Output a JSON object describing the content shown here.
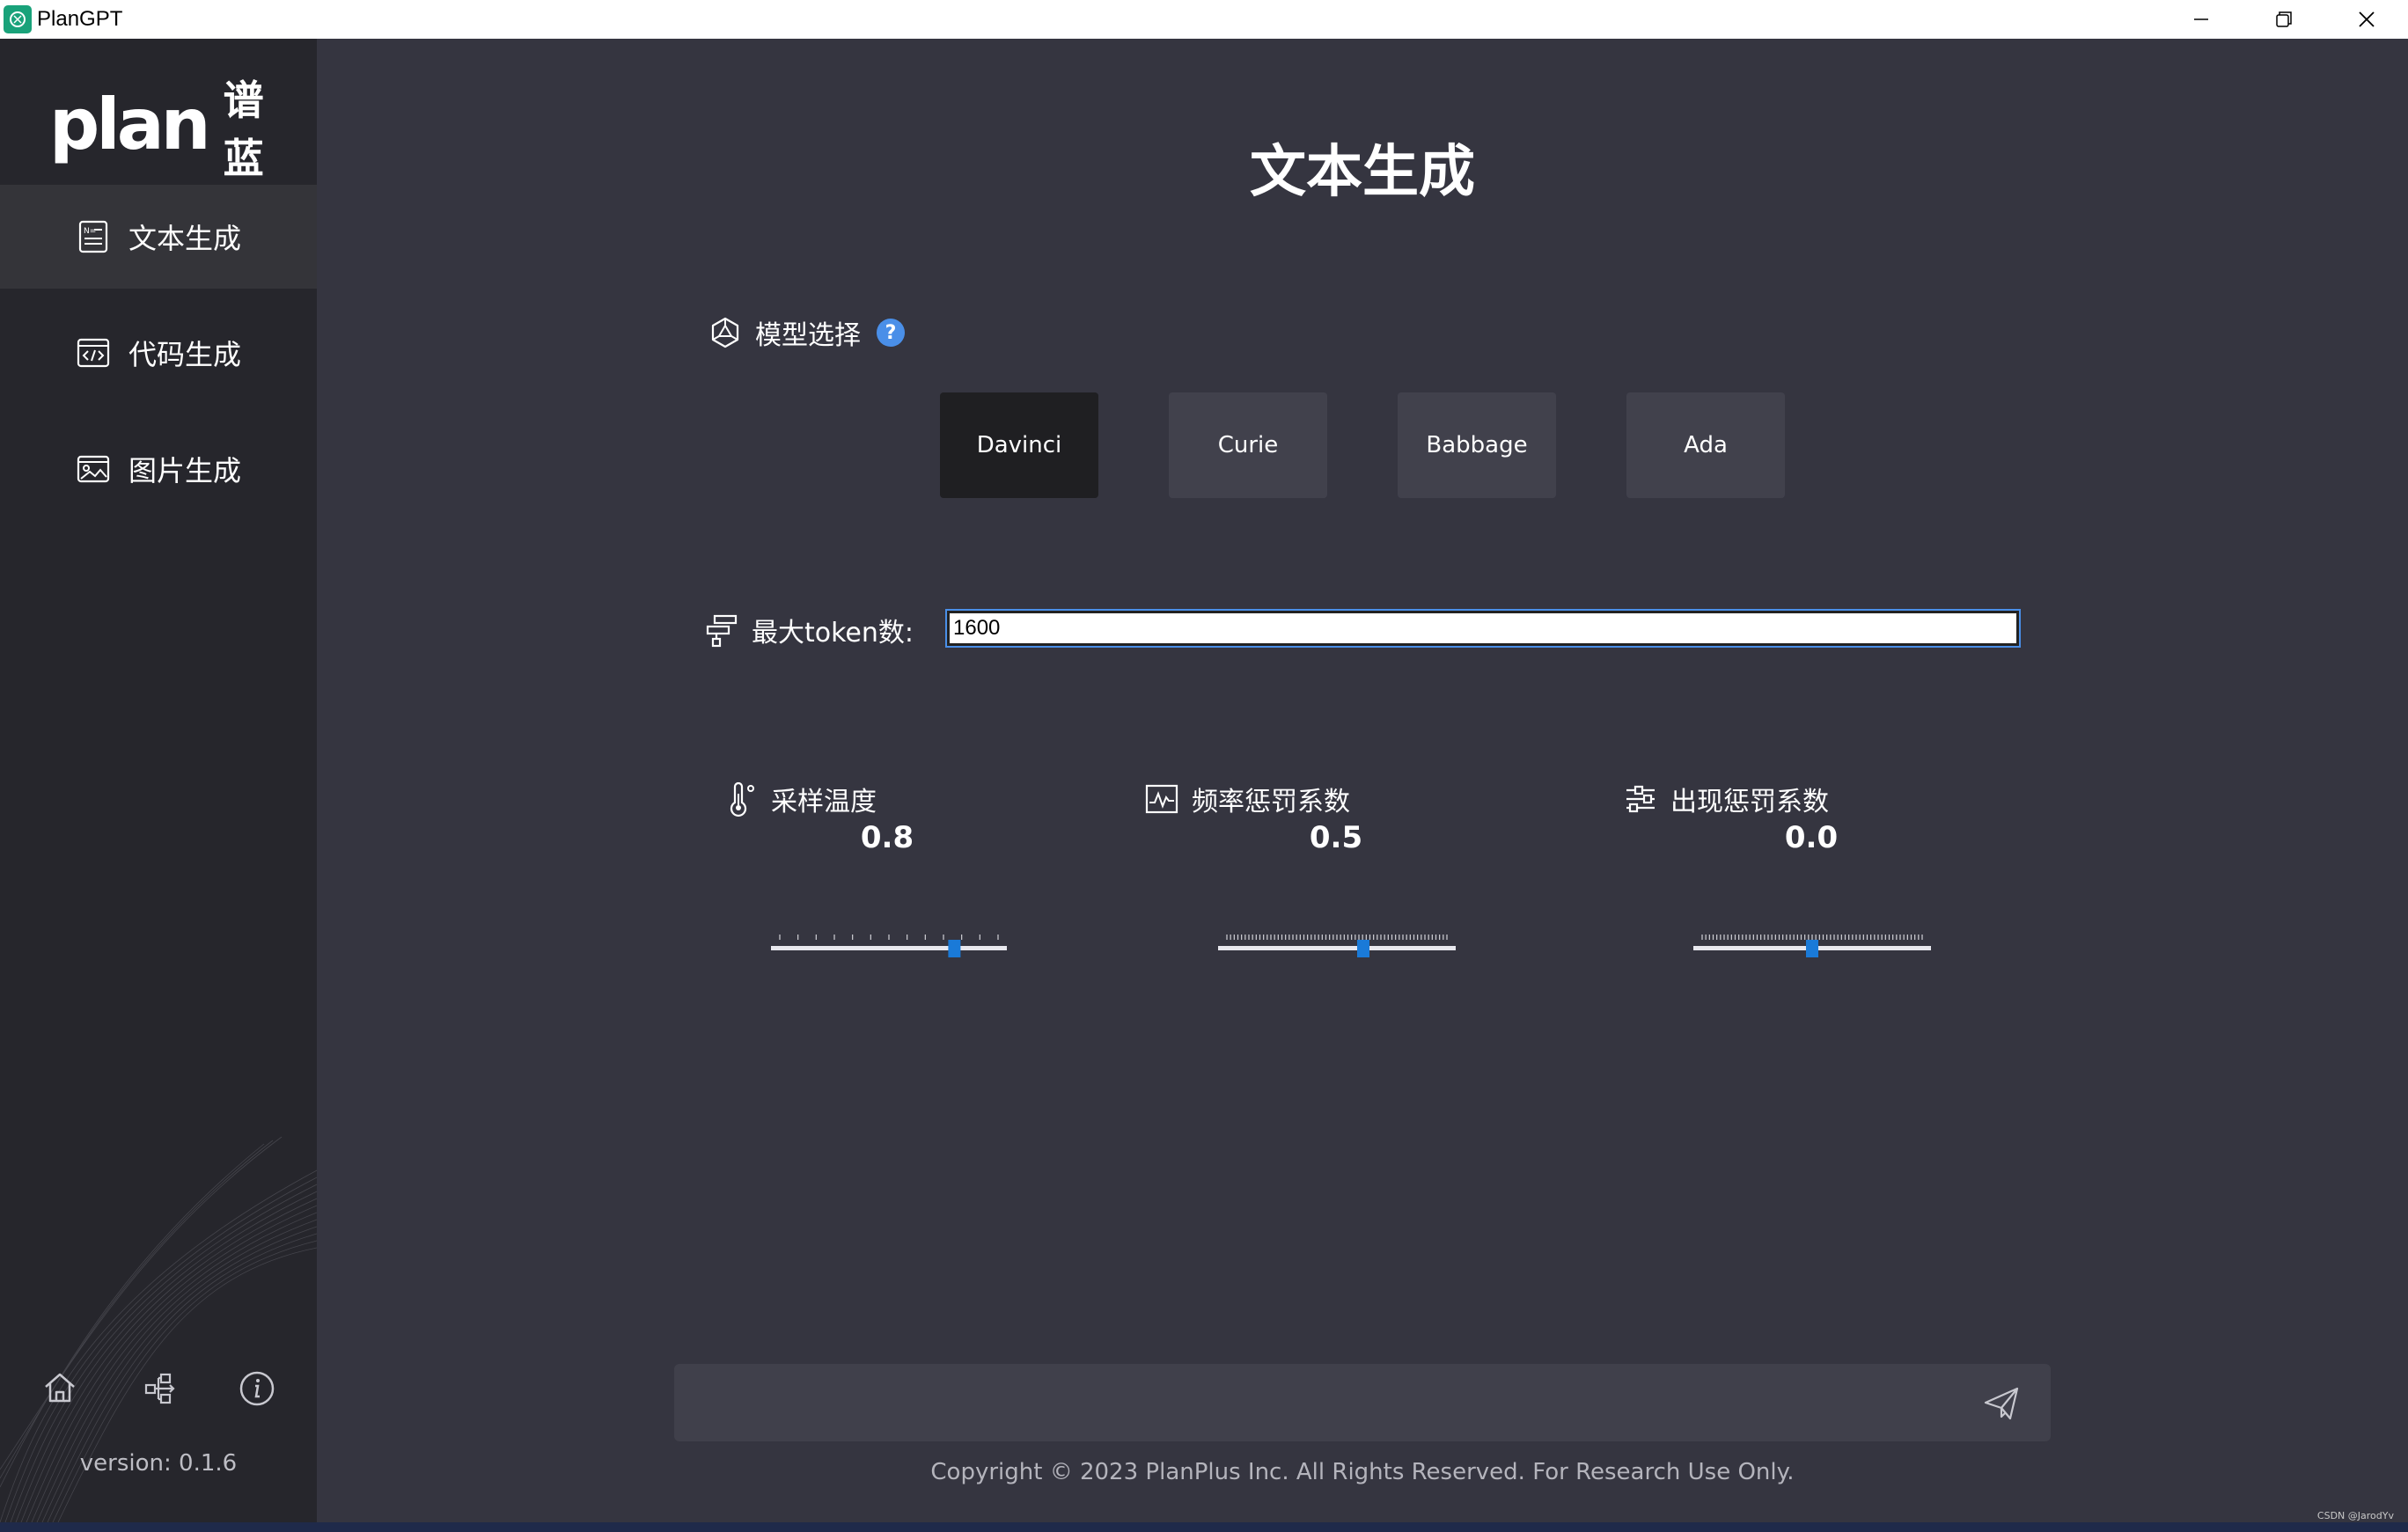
{
  "window": {
    "title": "PlanGPT"
  },
  "sidebar": {
    "logo_text": "plan",
    "logo_cn": "谱蓝",
    "items": [
      {
        "label": "文本生成",
        "icon": "text-doc-icon",
        "active": true
      },
      {
        "label": "代码生成",
        "icon": "code-icon",
        "active": false
      },
      {
        "label": "图片生成",
        "icon": "image-icon",
        "active": false
      }
    ],
    "bottom_icons": [
      "home-icon",
      "network-icon",
      "info-icon"
    ],
    "version": "version: 0.1.6"
  },
  "main": {
    "title": "文本生成",
    "model_select": {
      "label": "模型选择",
      "help": "?",
      "options": [
        "Davinci",
        "Curie",
        "Babbage",
        "Ada"
      ],
      "selected": "Davinci"
    },
    "max_tokens": {
      "label": "最大token数:",
      "value": "1600"
    },
    "sliders": [
      {
        "label": "采样温度",
        "value": "0.8",
        "position": 0.8
      },
      {
        "label": "频率惩罚系数",
        "value": "0.5",
        "position": 0.62
      },
      {
        "label": "出现惩罚系数",
        "value": "0.0",
        "position": 0.5
      }
    ],
    "chat_input": {
      "value": "",
      "send_icon": "send-icon"
    },
    "copyright": "Copyright © 2023 PlanPlus Inc. All Rights Reserved. For Research Use Only."
  },
  "watermark": "CSDN @JarodYv",
  "colors": {
    "background": "#353540",
    "sidebar": "#26262c",
    "active_item": "#343439",
    "button": "#41414c",
    "selected_button": "#1f1f22",
    "accent": "#4a8fe8",
    "slider_handle": "#1a7ad8"
  }
}
